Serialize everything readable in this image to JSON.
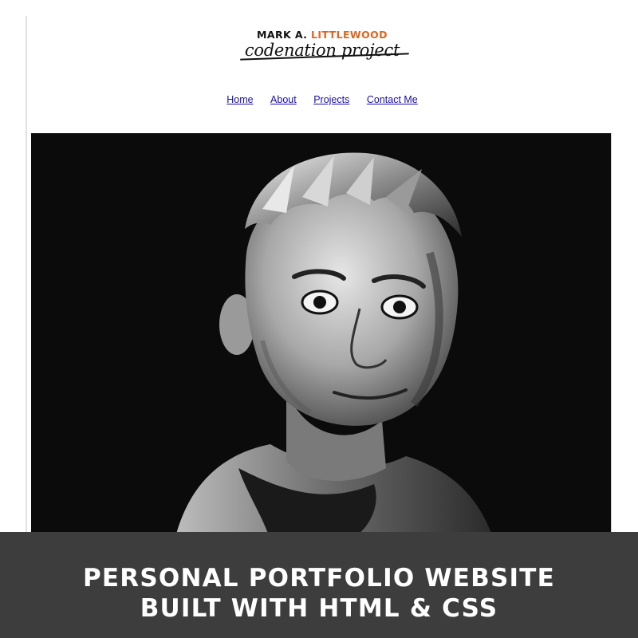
{
  "header": {
    "logo_name_first": "MARK A.",
    "logo_name_last": "LITTLEWOOD",
    "logo_tagline": "codenation project"
  },
  "nav": {
    "items": [
      "Home",
      "About",
      "Projects",
      "Contact Me"
    ]
  },
  "hero": {
    "image": "stylized black-and-white portrait of a man"
  },
  "banner": {
    "line1": "PERSONAL PORTFOLIO WEBSITE",
    "line2": "BUILT WITH HTML & CSS"
  },
  "colors": {
    "accent": "#e0651f",
    "link": "#1a0dab",
    "banner_bg": "#3d3d3d",
    "hero_bg": "#0b0b0b"
  }
}
